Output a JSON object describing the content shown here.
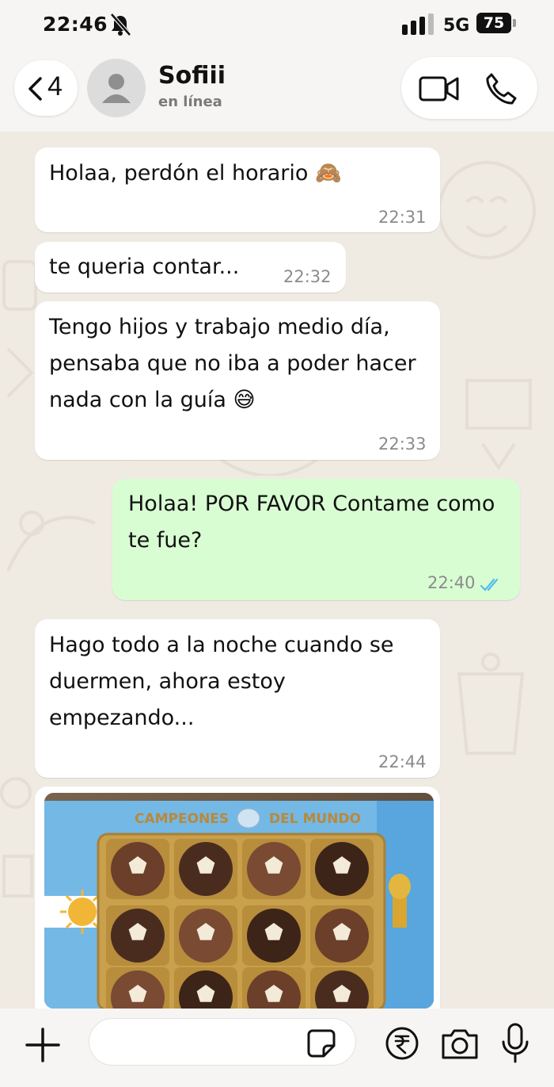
{
  "status_bar": {
    "time": "22:46",
    "network": "5G",
    "battery": "75"
  },
  "header": {
    "back_count": "4",
    "contact_name": "Sofiii",
    "contact_status": "en línea"
  },
  "messages": [
    {
      "direction": "incoming",
      "text": "Holaa, perdón el horario 🙈",
      "time": "22:31"
    },
    {
      "direction": "incoming",
      "text": "te queria contar...",
      "time": "22:32"
    },
    {
      "direction": "incoming",
      "lines": [
        "Tengo hijos y trabajo medio día,",
        "pensaba que no iba a poder hacer",
        "nada con la guía 😅"
      ],
      "time": "22:33"
    },
    {
      "direction": "outgoing",
      "lines": [
        "Holaa! POR FAVOR Contame como",
        "te fue?"
      ],
      "time": "22:40",
      "status": "read"
    },
    {
      "direction": "incoming",
      "lines": [
        "Hago todo a la noche cuando se",
        "duermen, ahora estoy",
        "empezando..."
      ],
      "time": "22:44"
    },
    {
      "direction": "incoming",
      "type": "image",
      "image_text": [
        "CAMPEONES",
        "DEL MUNDO"
      ]
    }
  ],
  "composer": {
    "placeholder": ""
  },
  "colors": {
    "incoming_bubble": "#ffffff",
    "outgoing_bubble": "#d9fdd3",
    "read_ticks": "#53bdeb",
    "background": "#efeae2"
  }
}
